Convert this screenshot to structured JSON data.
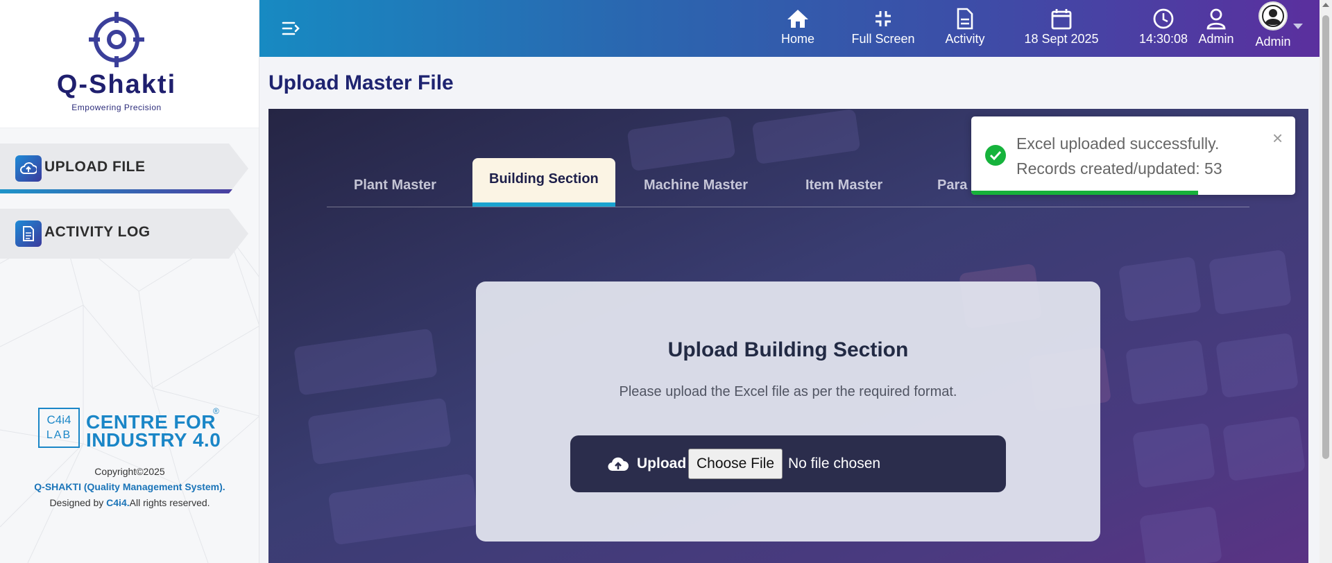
{
  "brand": {
    "name": "Q-Shakti",
    "tagline": "Empowering Precision"
  },
  "sidebar": {
    "items": [
      {
        "label": "UPLOAD FILE",
        "icon": "cloud-upload-icon",
        "active": true
      },
      {
        "label": "ACTIVITY LOG",
        "icon": "document-icon",
        "active": false
      }
    ],
    "footer": {
      "logo_box_top": "C4i4",
      "logo_box_bottom": "LAB",
      "logo_line1": "CENTRE FOR",
      "logo_line2": "INDUSTRY 4.0",
      "registered": "®",
      "copyright": "Copyright©2025",
      "system_name": "Q-SHAKTI (Quality Management System).",
      "designed_prefix": "Designed by ",
      "designed_by": "C4i4.",
      "rights": "All rights reserved."
    }
  },
  "header": {
    "home": "Home",
    "full_screen": "Full Screen",
    "activity": "Activity",
    "date": "18 Sept 2025",
    "time": "14:30:08",
    "user_role": "Admin",
    "profile_name": "Admin"
  },
  "page": {
    "title": "Upload Master File"
  },
  "tabs": [
    {
      "label": "Plant Master",
      "active": false
    },
    {
      "label": "Building Section",
      "active": true
    },
    {
      "label": "Machine Master",
      "active": false
    },
    {
      "label": "Item Master",
      "active": false
    },
    {
      "label": "Para",
      "active": false
    }
  ],
  "upload": {
    "title": "Upload Building Section",
    "subtitle": "Please upload the Excel file as per the required format.",
    "button_label": "Upload",
    "choose_file": "Choose File",
    "file_status": "No file chosen"
  },
  "toast": {
    "line1": "Excel uploaded successfully.",
    "line2": "Records created/updated: 53",
    "close": "×",
    "progress": 0.7
  },
  "colors": {
    "accent": "#1aa3cf",
    "brand_dark": "#1e2370",
    "success": "#16b33c"
  }
}
